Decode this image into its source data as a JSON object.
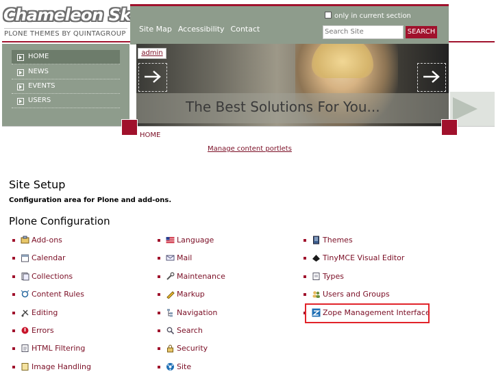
{
  "header": {
    "brand": "Chameleon Skin",
    "tagline": "PLONE THEMES BY QUINTAGROUP",
    "site_actions": [
      "Site Map",
      "Accessibility",
      "Contact"
    ],
    "current_section_label": "only in current section",
    "search_placeholder": "Search Site",
    "search_button": "SEARCH"
  },
  "nav": [
    "HOME",
    "NEWS",
    "EVENTS",
    "USERS"
  ],
  "banner": {
    "admin_tab": "admin",
    "headline": "The Best Solutions For You..."
  },
  "breadcrumb": "HOME",
  "manage_portlets": "Manage content portlets",
  "content": {
    "title": "Site Setup",
    "description": "Configuration area for Plone and add-ons.",
    "section_title": "Plone Configuration",
    "columns": [
      [
        "Add-ons",
        "Calendar",
        "Collections",
        "Content Rules",
        "Editing",
        "Errors",
        "HTML Filtering",
        "Image Handling"
      ],
      [
        "Language",
        "Mail",
        "Maintenance",
        "Markup",
        "Navigation",
        "Search",
        "Security",
        "Site"
      ],
      [
        "Themes",
        "TinyMCE Visual Editor",
        "Types",
        "Users and Groups",
        "Zope Management Interface"
      ]
    ],
    "icons": [
      [
        "addons-icon",
        "calendar-icon",
        "collections-icon",
        "content-rules-icon",
        "editing-icon",
        "errors-icon",
        "html-filtering-icon",
        "image-handling-icon"
      ],
      [
        "language-icon",
        "mail-icon",
        "maintenance-icon",
        "markup-icon",
        "navigation-icon",
        "search-icon",
        "security-icon",
        "site-icon"
      ],
      [
        "themes-icon",
        "tinymce-icon",
        "types-icon",
        "users-groups-icon",
        "zmi-icon"
      ]
    ],
    "highlighted_item": "Zope Management Interface"
  },
  "colors": {
    "accent": "#a0112c",
    "header_bg": "#8e9c8c",
    "link": "#7a0d24",
    "highlight_box": "#e12229"
  }
}
